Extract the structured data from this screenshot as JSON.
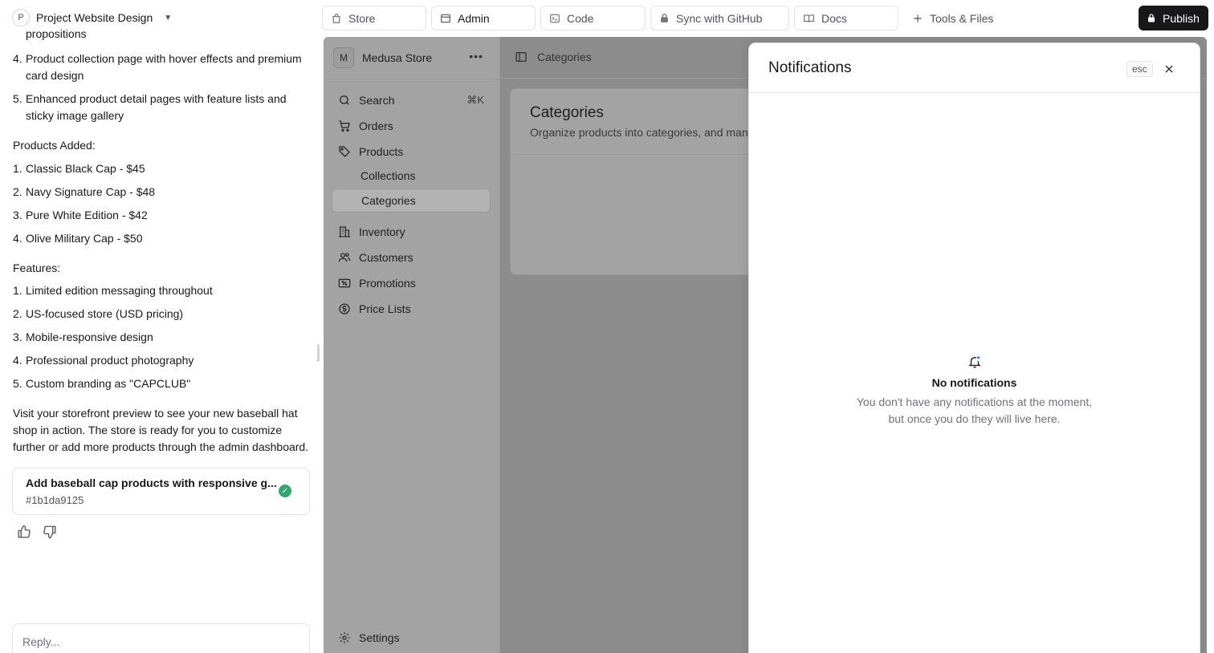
{
  "chat": {
    "project_initial": "P",
    "project_name": "Project Website Design",
    "partial_line": "propositions",
    "lines": [
      {
        "n": "4.",
        "text": "Product collection page with hover effects and premium card design"
      },
      {
        "n": "5.",
        "text": "Enhanced product detail pages with feature lists and sticky image gallery"
      }
    ],
    "products_heading": "Products Added:",
    "products": [
      {
        "n": "1.",
        "text": "Classic Black Cap - $45"
      },
      {
        "n": "2.",
        "text": "Navy Signature Cap - $48"
      },
      {
        "n": "3.",
        "text": "Pure White Edition - $42"
      },
      {
        "n": "4.",
        "text": "Olive Military Cap - $50"
      }
    ],
    "features_heading": "Features:",
    "features": [
      {
        "n": "1.",
        "text": "Limited edition messaging throughout"
      },
      {
        "n": "2.",
        "text": "US-focused store (USD pricing)"
      },
      {
        "n": "3.",
        "text": "Mobile-responsive design"
      },
      {
        "n": "4.",
        "text": "Professional product photography"
      },
      {
        "n": "5.",
        "text": "Custom branding as \"CAPCLUB\""
      }
    ],
    "closing": "Visit your storefront preview to see your new baseball hat shop in action. The store is ready for you to customize further or add more products through the admin dashboard.",
    "task_title": "Add baseball cap products with responsive g...",
    "task_id": "#1b1da9125",
    "reply_placeholder": "Reply..."
  },
  "topbar": {
    "tabs": [
      {
        "label": "Store",
        "icon": "bag-icon"
      },
      {
        "label": "Admin",
        "icon": "window-icon"
      },
      {
        "label": "Code",
        "icon": "terminal-icon"
      },
      {
        "label": "Sync with GitHub",
        "icon": "lock-icon"
      },
      {
        "label": "Docs",
        "icon": "book-icon"
      }
    ],
    "tools_label": "Tools & Files",
    "publish_label": "Publish"
  },
  "admin": {
    "store_initial": "M",
    "store_name": "Medusa Store",
    "search_label": "Search",
    "search_shortcut": "⌘K",
    "nav": {
      "orders": "Orders",
      "products": "Products",
      "collections": "Collections",
      "categories": "Categories",
      "inventory": "Inventory",
      "customers": "Customers",
      "promotions": "Promotions",
      "price_lists": "Price Lists",
      "settings": "Settings"
    },
    "breadcrumb": "Categories",
    "card_title": "Categories",
    "card_subtitle": "Organize products into categories, and mana"
  },
  "notifications": {
    "title": "Notifications",
    "esc_label": "esc",
    "empty_title": "No notifications",
    "empty_line1": "You don't have any notifications at the moment,",
    "empty_line2": "but once you do they will live here."
  },
  "colors": {
    "publish_bg": "#18181b",
    "success": "#34a56f",
    "overlay": "#8c8c8c",
    "notification_dot": "#3b82f6"
  }
}
